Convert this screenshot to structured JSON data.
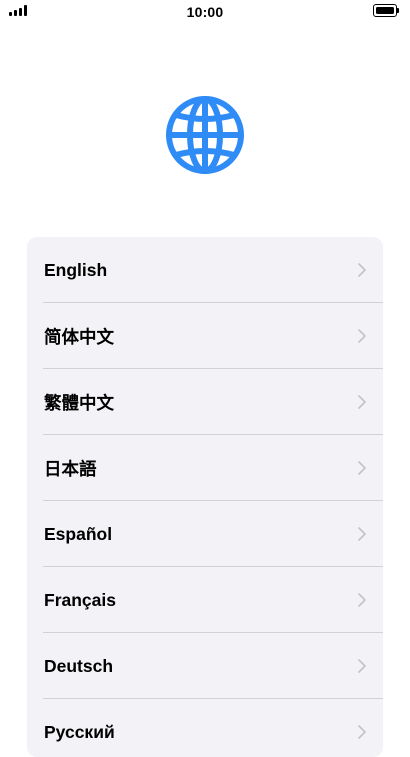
{
  "status_bar": {
    "time": "10:00",
    "signal_icon": "cellular-signal-icon",
    "battery_icon": "battery-icon"
  },
  "hero": {
    "icon": "globe-icon",
    "icon_color": "#2f8cf6"
  },
  "languages": [
    {
      "label": "English"
    },
    {
      "label": "简体中文"
    },
    {
      "label": "繁體中文"
    },
    {
      "label": "日本語"
    },
    {
      "label": "Español"
    },
    {
      "label": "Français"
    },
    {
      "label": "Deutsch"
    },
    {
      "label": "Русский"
    }
  ],
  "colors": {
    "card_background": "#f2f2f7",
    "separator": "#d1d1d6",
    "chevron": "#c4c4c7"
  }
}
